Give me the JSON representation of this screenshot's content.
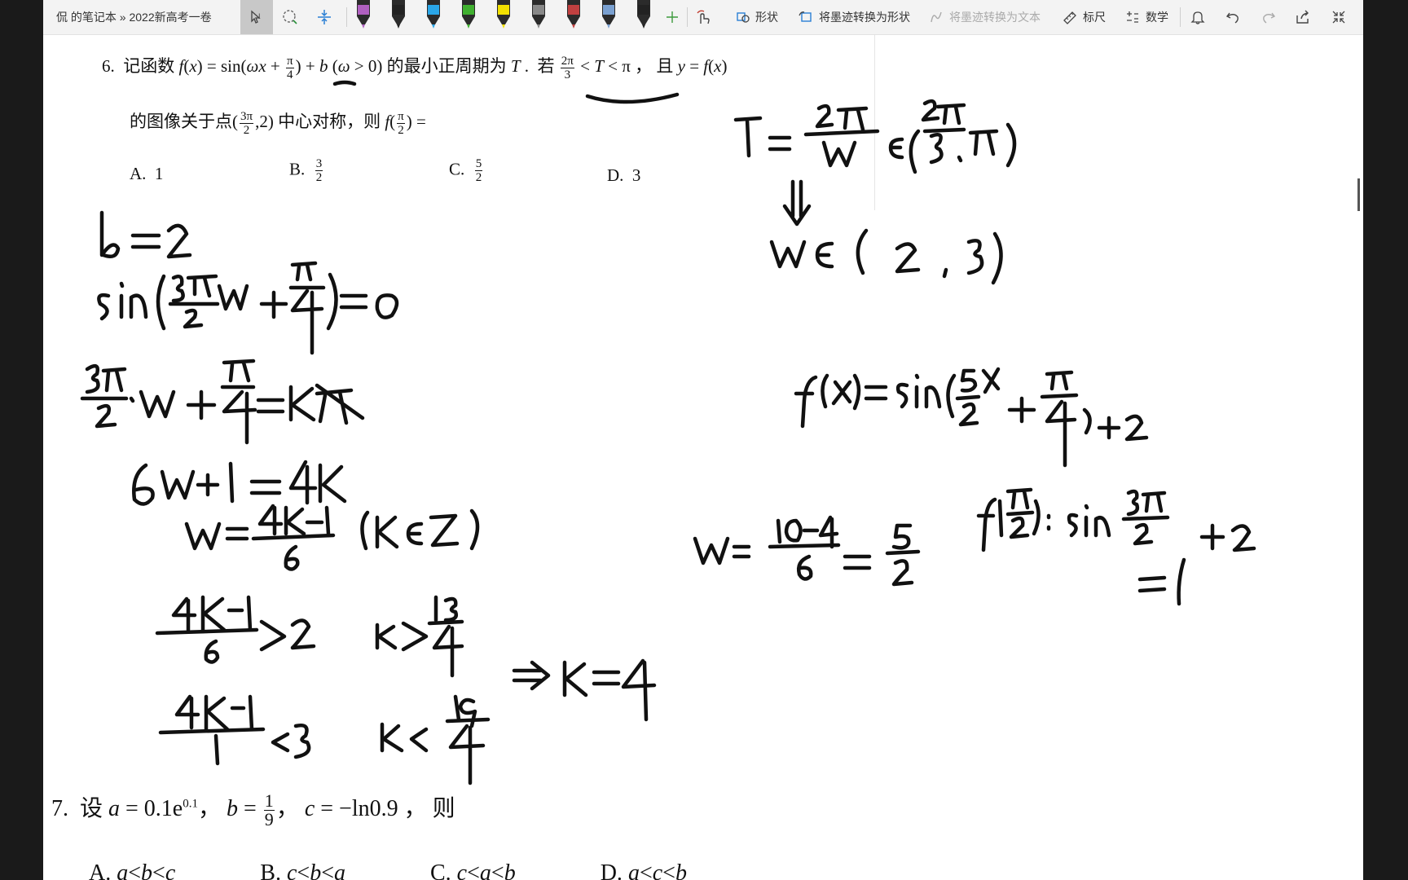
{
  "toolbar": {
    "breadcrumb": "侃 的笔记本 » 2022新高考一卷",
    "shape_label": "形状",
    "ink_to_shape_label": "将墨迹转换为形状",
    "ink_to_text_label": "将墨迹转换为文本",
    "ruler_label": "标尺",
    "math_label": "数学",
    "pen_colors": [
      "#b060c0",
      "#222222",
      "#2aa6e8",
      "#40b030",
      "#f2e000",
      "#888888",
      "#c04040",
      "#7aa0d0",
      "#222222"
    ]
  },
  "q6": {
    "number": "6.",
    "stem_a": "记函数",
    "stem_b": "的最小正周期为",
    "stem_c": "若",
    "stem_d": "且",
    "line2_a": "的图像关于点",
    "line2_b": "中心对称，则",
    "options": [
      {
        "letter": "A.",
        "value": "1"
      },
      {
        "letter": "B.",
        "value": "3/2"
      },
      {
        "letter": "C.",
        "value": "5/2"
      },
      {
        "letter": "D.",
        "value": "3"
      }
    ]
  },
  "q7": {
    "number": "7.",
    "stem": "设",
    "tail": "则",
    "options_partial": [
      "A.",
      "B.",
      "C.",
      "D."
    ]
  }
}
